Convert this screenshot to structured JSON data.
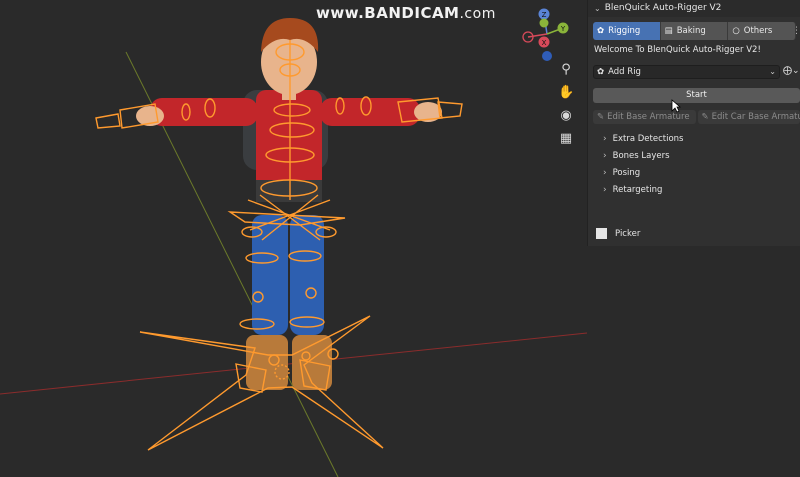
{
  "watermark": {
    "text_bold": "www.BANDICAM",
    "text_rest": ".com"
  },
  "gizmo": {
    "z": "Z",
    "y": "Y",
    "x": "X"
  },
  "nav_tools": [
    "zoom-icon",
    "hand-icon",
    "camera-icon",
    "grid-icon"
  ],
  "panel": {
    "title": "BlenQuick Auto-Rigger V2",
    "tabs": [
      {
        "label": "Rigging",
        "icon": "armature-icon",
        "active": true
      },
      {
        "label": "Baking",
        "icon": "bake-icon",
        "active": false
      },
      {
        "label": "Others",
        "icon": "circle-icon",
        "active": false
      }
    ],
    "welcome": "Welcome To BlenQuick Auto-Rigger V2!",
    "rig_select": "Add Rig",
    "start_label": "Start",
    "edit_base": "Edit Base Armature",
    "edit_car": "Edit Car Base Armature",
    "sections": [
      "Extra Detections",
      "Bones Layers",
      "Posing",
      "Retargeting"
    ],
    "picker_label": "Picker"
  },
  "colors": {
    "accent": "#4772b3",
    "bone_orange": "#ff9a2e",
    "x_axis": "#8b2c2c",
    "y_axis": "#6b7a2a"
  }
}
